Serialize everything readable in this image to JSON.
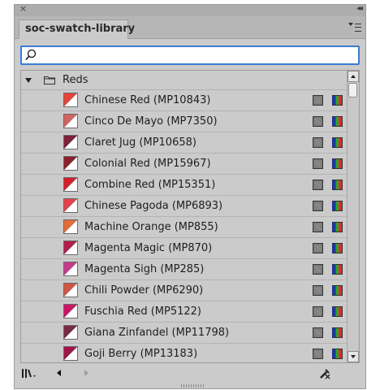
{
  "titlebar": {
    "close_icon": "close-icon",
    "collapse_icon": "double-chevron-left-icon"
  },
  "tab": {
    "label": "soc-swatch-library"
  },
  "panel_menu_icon": "panel-menu-icon",
  "search": {
    "value": "",
    "placeholder": ""
  },
  "group": {
    "name": "Reds",
    "expanded": true
  },
  "swatches": [
    {
      "label": "Chinese Red (MP10843)",
      "color": "#e3443c"
    },
    {
      "label": "Cinco De Mayo (MP7350)",
      "color": "#cf6462"
    },
    {
      "label": "Claret Jug (MP10658)",
      "color": "#7e2039"
    },
    {
      "label": "Colonial Red (MP15967)",
      "color": "#8e1f2c"
    },
    {
      "label": "Combine Red (MP15351)",
      "color": "#d4202e"
    },
    {
      "label": "Chinese Pagoda (MP6893)",
      "color": "#e2424b"
    },
    {
      "label": "Machine Orange (MP855)",
      "color": "#e26c3c"
    },
    {
      "label": "Magenta Magic (MP870)",
      "color": "#b11f4c"
    },
    {
      "label": "Magenta Sigh (MP285)",
      "color": "#c63b89"
    },
    {
      "label": "Chili Powder (MP6290)",
      "color": "#cf5644"
    },
    {
      "label": "Fuschia Red (MP5122)",
      "color": "#cc1464"
    },
    {
      "label": "Giana Zinfandel (MP11798)",
      "color": "#7a2a48"
    },
    {
      "label": "Goji Berry (MP13183)",
      "color": "#a01548"
    }
  ],
  "colors": {
    "panel_bg": "#cbcbcb",
    "search_focus": "#3a7bd5"
  },
  "bottombar": {
    "library_icon": "library-menu-icon",
    "prev_icon": "previous-arrow-icon",
    "next_icon": "next-arrow-icon",
    "delete_icon": "delete-swatch-icon"
  }
}
